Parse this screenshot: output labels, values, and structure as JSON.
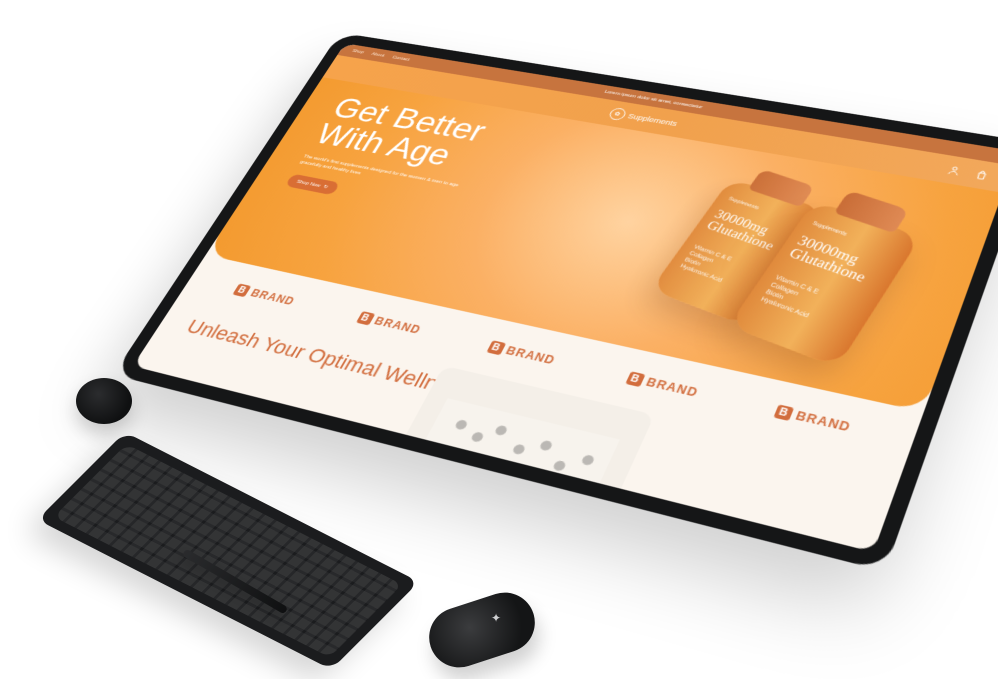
{
  "announcement": {
    "text": "Lorem ipsum dolor sit amet, consectetur"
  },
  "nav": {
    "links": [
      "Shop",
      "About",
      "Contact"
    ]
  },
  "header": {
    "logo_text": "Supplements",
    "logo_mark": "✿",
    "icons": [
      "user-icon",
      "bag-icon"
    ]
  },
  "hero": {
    "title_line1": "Get Better",
    "title_line2": "With Age",
    "subtitle": "The world's first supplements designed for the women & men to age gracefully and healthy lives",
    "button_label": "Shop Now",
    "button_icon": "↻",
    "bottle_brand": "Supplements",
    "bottle_title": "30000mg Glutathione",
    "bottle_small": "Vitamin C & E\nCollagen\nBiotin\nHyaluronic Acid"
  },
  "brands": {
    "items": [
      "BRAND",
      "BRAND",
      "BRAND",
      "BRAND",
      "BRAND"
    ]
  },
  "wellness": {
    "title": "Unleash Your Optimal Wellness:"
  },
  "colors": {
    "accent": "#D26D3D",
    "hero_orange": "#F7A33F",
    "announcement": "#C7743E"
  }
}
